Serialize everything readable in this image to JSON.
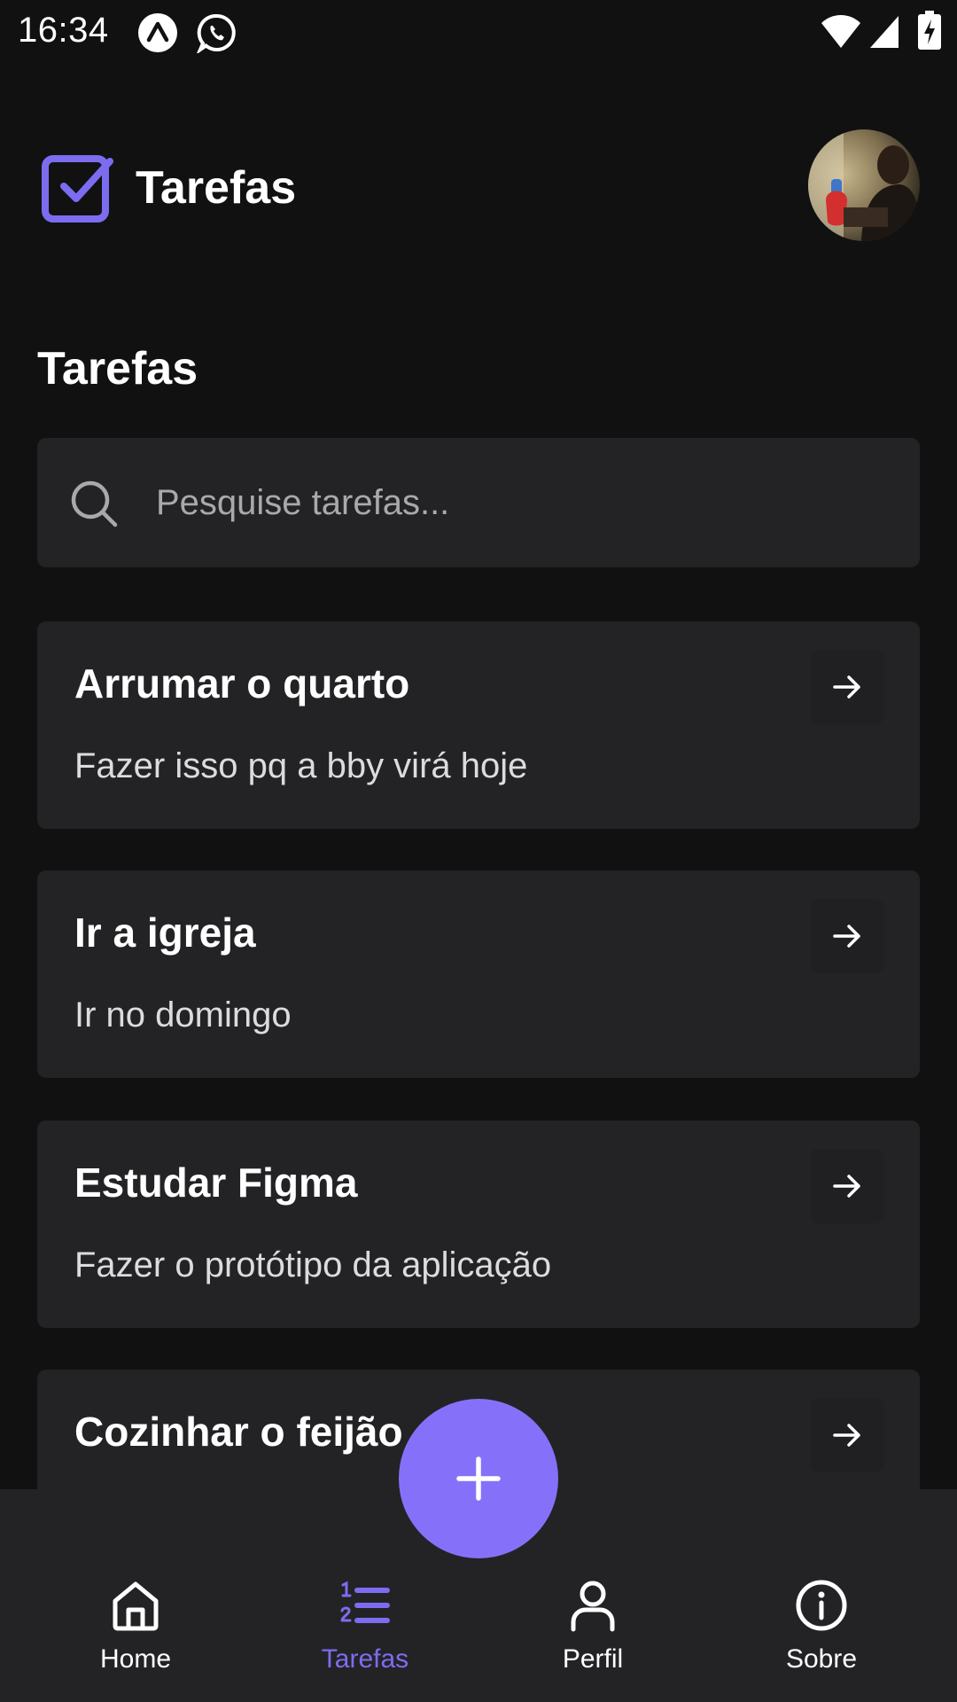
{
  "status_bar": {
    "time": "16:34",
    "left_icons": [
      "expo-go-icon",
      "whatsapp-icon"
    ],
    "right_icons": [
      "wifi-icon",
      "cellular-signal-icon",
      "battery-charging-icon"
    ]
  },
  "header": {
    "app_title": "Tarefas",
    "logo_icon": "checkbox-checked-icon",
    "avatar": "user-avatar"
  },
  "main": {
    "section_title": "Tarefas",
    "search": {
      "placeholder": "Pesquise tarefas...",
      "value": ""
    },
    "tasks": [
      {
        "title": "Arrumar o quarto",
        "description": "Fazer isso pq a bby virá hoje"
      },
      {
        "title": "Ir a igreja",
        "description": "Ir no domingo"
      },
      {
        "title": "Estudar Figma",
        "description": "Fazer o protótipo da aplicação"
      },
      {
        "title": "Cozinhar o feijão",
        "description": ""
      }
    ]
  },
  "fab": {
    "icon": "plus-icon"
  },
  "bottom_nav": {
    "items": [
      {
        "label": "Home",
        "icon": "home-icon",
        "active": false
      },
      {
        "label": "Tarefas",
        "icon": "list-ordered-icon",
        "active": true
      },
      {
        "label": "Perfil",
        "icon": "user-icon",
        "active": false
      },
      {
        "label": "Sobre",
        "icon": "info-icon",
        "active": false
      }
    ]
  },
  "colors": {
    "background": "#111112",
    "surface": "#232325",
    "accent": "#8571f9",
    "accent_text": "#7c6cf0",
    "muted_text": "#a9a9ad"
  }
}
